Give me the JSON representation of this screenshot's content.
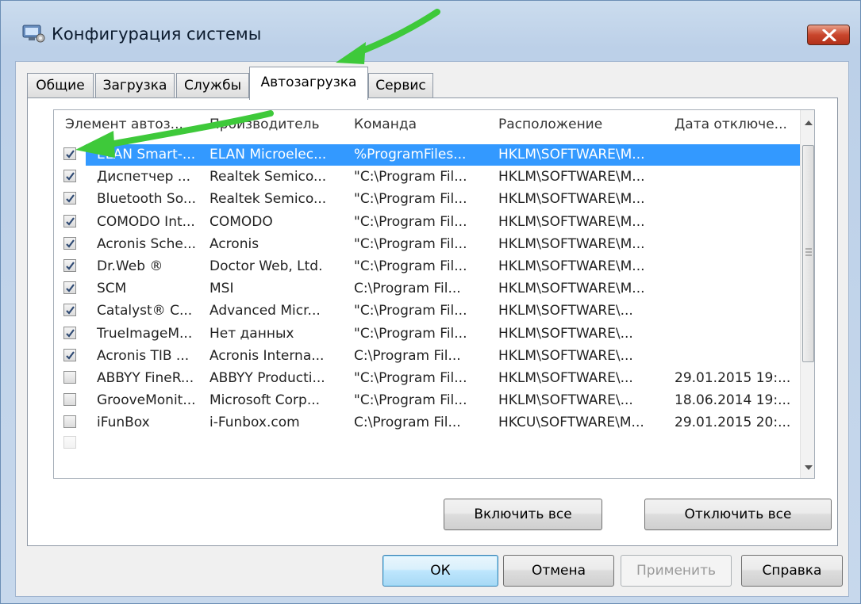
{
  "window": {
    "title": "Конфигурация системы"
  },
  "tabs": [
    {
      "label": "Общие"
    },
    {
      "label": "Загрузка"
    },
    {
      "label": "Службы"
    },
    {
      "label": "Автозагрузка"
    },
    {
      "label": "Сервис"
    }
  ],
  "list": {
    "columns": [
      "Элемент автоз...",
      "Производитель",
      "Команда",
      "Расположение",
      "Дата отключе..."
    ],
    "rows": [
      {
        "checked": true,
        "selected": true,
        "item": "ELAN Smart-...",
        "vendor": "ELAN Microelec...",
        "command": "%ProgramFiles...",
        "location": "HKLM\\SOFTWARE\\M...",
        "date": ""
      },
      {
        "checked": true,
        "item": "Диспетчер ...",
        "vendor": "Realtek Semico...",
        "command": "\"C:\\Program Fil...",
        "location": "HKLM\\SOFTWARE\\M...",
        "date": ""
      },
      {
        "checked": true,
        "item": "Bluetooth So...",
        "vendor": "Realtek Semico...",
        "command": "\"C:\\Program Fil...",
        "location": "HKLM\\SOFTWARE\\M...",
        "date": ""
      },
      {
        "checked": true,
        "item": "COMODO Int...",
        "vendor": "COMODO",
        "command": "\"C:\\Program Fil...",
        "location": "HKLM\\SOFTWARE\\M...",
        "date": ""
      },
      {
        "checked": true,
        "item": "Acronis Sche...",
        "vendor": "Acronis",
        "command": "\"C:\\Program Fil...",
        "location": "HKLM\\SOFTWARE\\M...",
        "date": ""
      },
      {
        "checked": true,
        "item": "Dr.Web ®",
        "vendor": "Doctor Web, Ltd.",
        "command": "\"C:\\Program Fil...",
        "location": "HKLM\\SOFTWARE\\M...",
        "date": ""
      },
      {
        "checked": true,
        "item": "SCM",
        "vendor": "MSI",
        "command": "C:\\Program Fil...",
        "location": "HKLM\\SOFTWARE\\M...",
        "date": ""
      },
      {
        "checked": true,
        "item": "Catalyst® C...",
        "vendor": "Advanced Micr...",
        "command": "\"C:\\Program Fil...",
        "location": "HKLM\\SOFTWARE\\...",
        "date": ""
      },
      {
        "checked": true,
        "item": "TrueImageM...",
        "vendor": "Нет данных",
        "command": "\"C:\\Program Fil...",
        "location": "HKLM\\SOFTWARE\\...",
        "date": ""
      },
      {
        "checked": true,
        "item": "Acronis TIB ...",
        "vendor": "Acronis Interna...",
        "command": "C:\\Program Fil...",
        "location": "HKLM\\SOFTWARE\\...",
        "date": ""
      },
      {
        "checked": false,
        "item": "ABBYY FineR...",
        "vendor": "ABBYY Producti...",
        "command": "\"C:\\Program Fil...",
        "location": "HKLM\\SOFTWARE\\...",
        "date": "29.01.2015 19:..."
      },
      {
        "checked": false,
        "item": "GrooveMonit...",
        "vendor": "Microsoft Corp...",
        "command": "\"C:\\Program Fil...",
        "location": "HKLM\\SOFTWARE\\...",
        "date": "18.06.2014 19:..."
      },
      {
        "checked": false,
        "item": "iFunBox",
        "vendor": "i-Funbox.com",
        "command": "C:\\Program Fil...",
        "location": "HKCU\\SOFTWARE\\M...",
        "date": "29.01.2015 20:..."
      }
    ]
  },
  "buttons": {
    "enable_all": "Включить все",
    "disable_all": "Отключить все",
    "ok": "ОК",
    "cancel": "Отмена",
    "apply": "Применить",
    "help": "Справка"
  },
  "colors": {
    "selection": "#3399ff",
    "annotation_arrow": "#3ec93a",
    "close_button": "#c9462c"
  },
  "icons": [
    "system-config-icon",
    "close-icon",
    "checkbox-check-icon",
    "scroll-up-icon",
    "scroll-down-icon",
    "annotation-arrow-icon"
  ]
}
